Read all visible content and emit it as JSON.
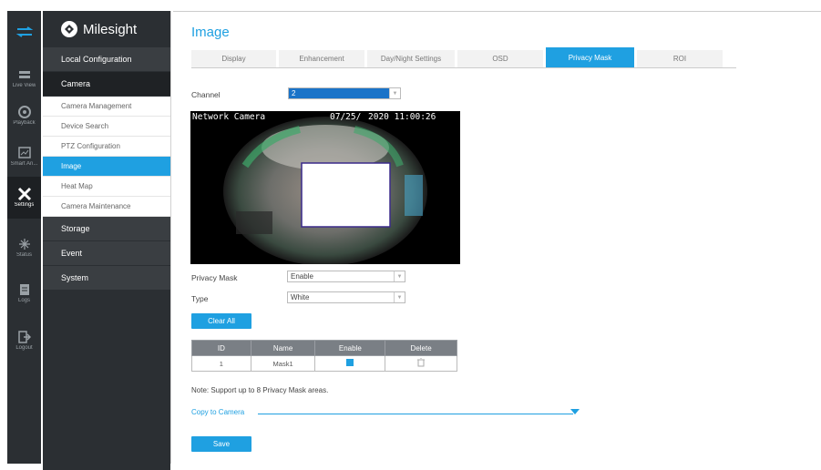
{
  "rail": {
    "items": [
      {
        "label": "",
        "icon": "transfer-icon"
      },
      {
        "label": "Live View",
        "icon": "live-view-icon"
      },
      {
        "label": "Playback",
        "icon": "playback-icon"
      },
      {
        "label": "Smart An...",
        "icon": "smart-analytics-icon"
      },
      {
        "label": "Settings",
        "icon": "settings-icon"
      },
      {
        "label": "Status",
        "icon": "status-icon"
      },
      {
        "label": "Logs",
        "icon": "logs-icon"
      },
      {
        "label": "Logout",
        "icon": "logout-icon"
      }
    ]
  },
  "brand": {
    "name": "Milesight"
  },
  "nav": {
    "local_config": "Local Configuration",
    "camera": "Camera",
    "camera_items": [
      "Camera Management",
      "Device Search",
      "PTZ Configuration",
      "Image",
      "Heat Map",
      "Camera Maintenance"
    ],
    "storage": "Storage",
    "event": "Event",
    "system": "System"
  },
  "page": {
    "title": "Image",
    "tabs": [
      "Display",
      "Enhancement",
      "Day/Night Settings",
      "OSD",
      "Privacy Mask",
      "ROI"
    ],
    "active_tab": "Privacy Mask"
  },
  "form": {
    "channel_label": "Channel",
    "channel_value": "2",
    "privacy_mask_label": "Privacy Mask",
    "privacy_mask_value": "Enable",
    "type_label": "Type",
    "type_value": "White",
    "clear_all": "Clear All",
    "save": "Save"
  },
  "video": {
    "osd_name": "Network Camera",
    "osd_time": "2020 11:00:26",
    "osd_date_partial": "07/25/"
  },
  "mask_table": {
    "headers": [
      "ID",
      "Name",
      "Enable",
      "Delete"
    ],
    "rows": [
      {
        "id": "1",
        "name": "Mask1",
        "enabled": true
      }
    ]
  },
  "note": "Note: Support up to 8 Privacy Mask areas.",
  "copy_to_camera": "Copy to Camera",
  "colors": {
    "accent": "#1fa0e1",
    "dark": "#2b2f33"
  }
}
